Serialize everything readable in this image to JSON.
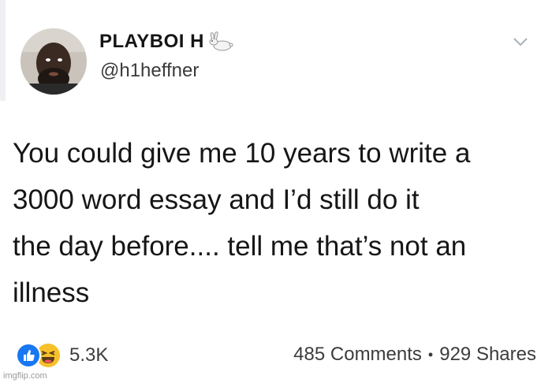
{
  "tweet": {
    "display_name": "PLAYBOI H",
    "handle": "@h1heffner",
    "text": "You could give me 10 years to write a\n3000 word essay and I’d still do it\nthe day before.... tell me that’s not an\nillness",
    "name_emoji": "rabbit-icon"
  },
  "post_footer": {
    "reaction_count": "5.3K",
    "comments": "485 Comments",
    "shares": "929 Shares",
    "separator": "•",
    "reaction_icons": [
      "like-icon",
      "haha-icon"
    ]
  },
  "watermark": "imgflip.com",
  "colors": {
    "like_blue": "#1877f2",
    "haha_yellow": "#f7c12b",
    "text": "#161616",
    "muted": "#3c3c3c"
  }
}
